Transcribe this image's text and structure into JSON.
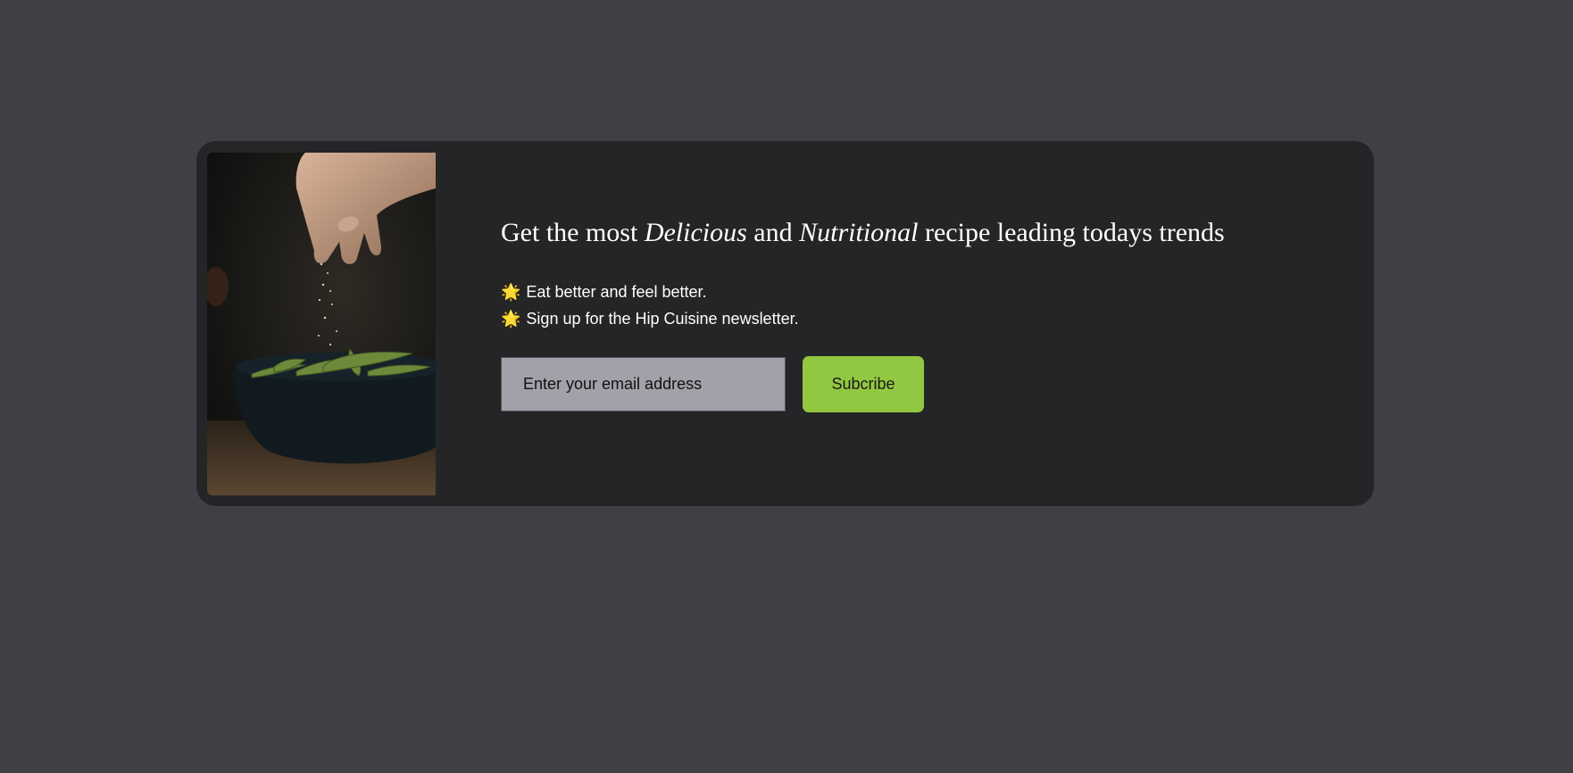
{
  "newsletter": {
    "heading": {
      "part1": "Get the most ",
      "emphasis1": "Delicious",
      "part2": " and ",
      "emphasis2": "Nutritional",
      "part3": " recipe leading todays trends"
    },
    "bullets": [
      {
        "icon": "glowing-star-icon",
        "text": "Eat better and feel better."
      },
      {
        "icon": "glowing-star-icon",
        "text": "Sign up for the Hip Cuisine newsletter."
      }
    ],
    "star_glyph": "🌟",
    "email_placeholder": "Enter your email address",
    "subscribe_label": "Subcribe"
  },
  "colors": {
    "page_background": "#403f46",
    "card_background": "#252527",
    "input_background": "#a1a1aa",
    "button_accent": "#92c841"
  }
}
